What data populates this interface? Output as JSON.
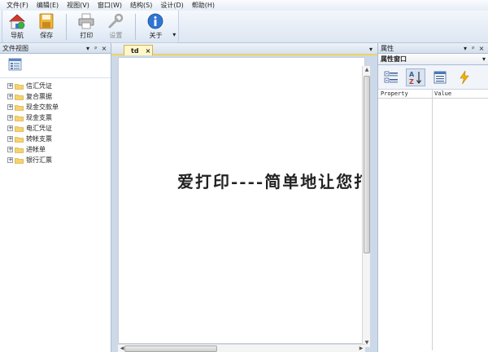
{
  "menu": [
    "文件(F)",
    "编辑(E)",
    "视图(V)",
    "窗口(W)",
    "结构(S)",
    "设计(D)",
    "帮助(H)"
  ],
  "toolbar": {
    "navigate": "导航",
    "save": "保存",
    "print": "打印",
    "settings": "设置",
    "about": "关于"
  },
  "left_panel": {
    "title": "文件视图",
    "controls": [
      "▾",
      "ᵖ",
      "×"
    ],
    "tree": [
      "信汇凭证",
      "复合票据",
      "现金交款单",
      "现金支票",
      "电汇凭证",
      "转帐支票",
      "进帐单",
      "银行汇票"
    ]
  },
  "document": {
    "tab_label": "td",
    "tab_close": "×",
    "content_text": "爱打印----简单地让您打",
    "tab_scroll": "▾",
    "tab_close_all": "×"
  },
  "right_panel": {
    "title": "属性",
    "controls": [
      "▾",
      "ᵖ",
      "×"
    ],
    "combo": "属性窗口",
    "grid_headers": [
      "Property",
      "Value"
    ]
  },
  "icons": {
    "navigate": "home-icon",
    "save": "floppy-disk-icon",
    "print": "printer-icon",
    "settings": "wrench-icon",
    "about": "info-icon",
    "categorized": "categorized-icon",
    "alphabetical": "sort-az-icon",
    "properties": "property-pages-icon",
    "events": "lightning-icon"
  },
  "colors": {
    "tab_accent": "#f2d35a",
    "frame": "#cfdceb"
  }
}
